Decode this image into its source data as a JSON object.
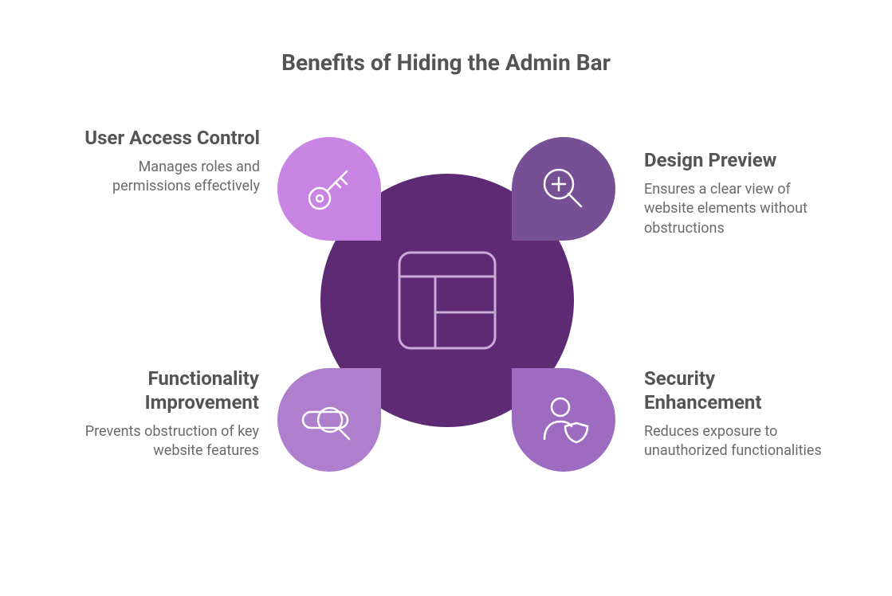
{
  "title": "Benefits of Hiding the Admin Bar",
  "colors": {
    "center": "#5e2a74",
    "petal_tl": "#c884e3",
    "petal_tr": "#774f95",
    "petal_bl": "#ad7fcc",
    "petal_br": "#9d6cc0",
    "icon_stroke": "#ffffff",
    "text_title": "#545454",
    "text_desc": "#6a6a6a"
  },
  "center_icon": "layout-grid",
  "petals": {
    "tl": {
      "title": "User Access Control",
      "desc": "Manages roles and permissions effectively",
      "icon": "key"
    },
    "tr": {
      "title": "Design Preview",
      "desc": "Ensures a clear view of website elements without obstructions",
      "icon": "zoom-in"
    },
    "bl": {
      "title": "Functionality Improvement",
      "desc": "Prevents obstruction of key website features",
      "icon": "feature-search"
    },
    "br": {
      "title": "Security Enhancement",
      "desc": "Reduces exposure to unauthorized functionalities",
      "icon": "user-shield"
    }
  }
}
